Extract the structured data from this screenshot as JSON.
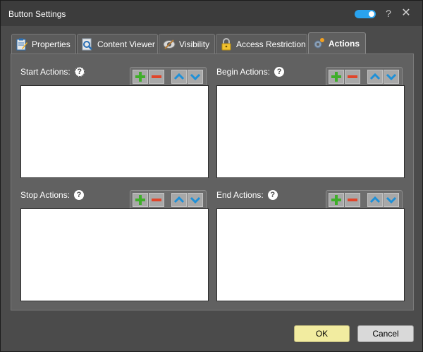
{
  "window": {
    "title": "Button Settings",
    "help_glyph": "?",
    "close_glyph": "✕"
  },
  "tabs": [
    {
      "label": "Properties",
      "icon": "properties-icon",
      "active": false
    },
    {
      "label": "Content Viewer",
      "icon": "content-viewer-icon",
      "active": false
    },
    {
      "label": "Visibility",
      "icon": "visibility-icon",
      "active": false
    },
    {
      "label": "Access Restriction",
      "icon": "lock-icon",
      "active": false
    },
    {
      "label": "Actions",
      "icon": "gear-icon",
      "active": true
    }
  ],
  "groups": {
    "start": {
      "label": "Start Actions:",
      "help": "?"
    },
    "begin": {
      "label": "Begin Actions:",
      "help": "?"
    },
    "stop": {
      "label": "Stop Actions:",
      "help": "?"
    },
    "end": {
      "label": "End Actions:",
      "help": "?"
    }
  },
  "footer": {
    "ok_label": "OK",
    "cancel_label": "Cancel"
  },
  "colors": {
    "accent_toggle": "#29a3ef",
    "add_green": "#3fae2a",
    "remove_red": "#e0452a",
    "move_blue": "#1e90d8",
    "ok_button": "#f2eca0"
  }
}
